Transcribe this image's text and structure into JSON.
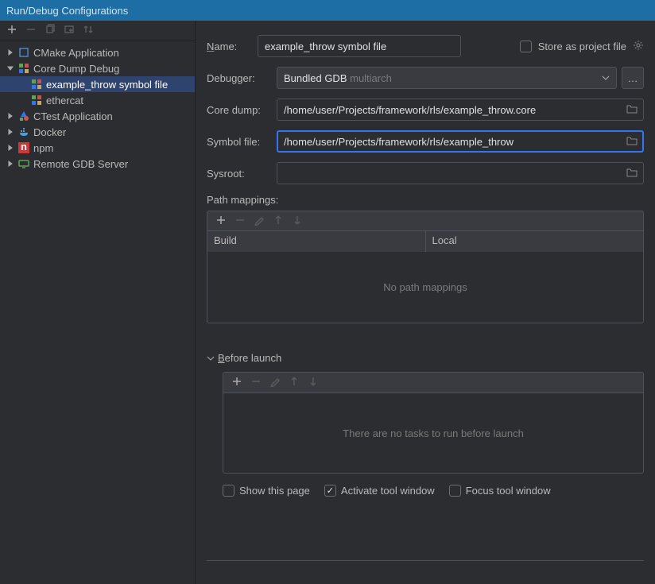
{
  "title": "Run/Debug Configurations",
  "tree": {
    "items": [
      {
        "label": "CMake Application",
        "expanded": false
      },
      {
        "label": "Core Dump Debug",
        "expanded": true,
        "children": [
          {
            "label": "example_throw symbol file",
            "selected": true
          },
          {
            "label": "ethercat",
            "selected": false
          }
        ]
      },
      {
        "label": "CTest Application",
        "expanded": false
      },
      {
        "label": "Docker",
        "expanded": false
      },
      {
        "label": "npm",
        "expanded": false
      },
      {
        "label": "Remote GDB Server",
        "expanded": false
      }
    ]
  },
  "form": {
    "name_label": "Name:",
    "name_value": "example_throw symbol file",
    "store_label": "Store as project file",
    "debugger_label": "Debugger:",
    "debugger_value": "Bundled GDB",
    "debugger_suffix": " multiarch",
    "coredump_label": "Core dump:",
    "coredump_value": "/home/user/Projects/framework/rls/example_throw.core",
    "symbol_label": "Symbol file:",
    "symbol_value": "/home/user/Projects/framework/rls/example_throw",
    "sysroot_label": "Sysroot:",
    "sysroot_value": "",
    "path_mappings_label": "Path mappings:",
    "col_build": "Build",
    "col_local": "Local",
    "no_mappings": "No path mappings",
    "before_launch_label": "Before launch",
    "no_tasks": "There are no tasks to run before launch",
    "show_page": "Show this page",
    "activate_tool": "Activate tool window",
    "focus_tool": "Focus tool window"
  }
}
